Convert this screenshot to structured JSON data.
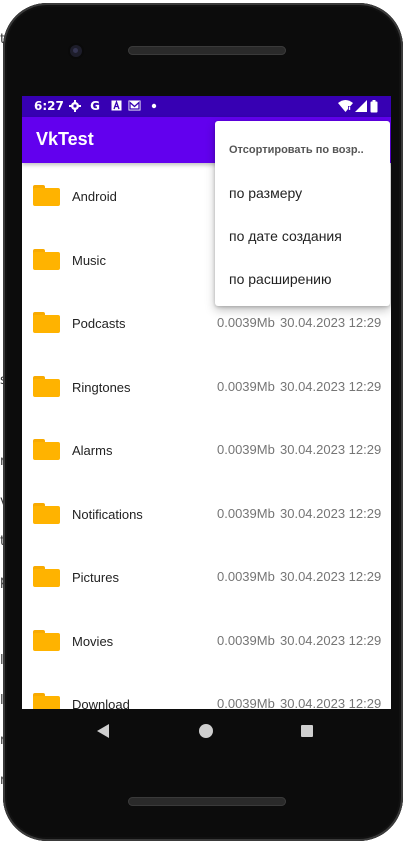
{
  "background_glyphs": [
    "t",
    "s",
    "n",
    "v",
    "t",
    "p",
    "l",
    "l",
    "n",
    "n"
  ],
  "status_bar": {
    "time": "6:27",
    "left_icons": [
      "gear-icon",
      "google-icon",
      "a-box-icon",
      "gmail-icon",
      "dot-icon"
    ],
    "right_icons": [
      "wifi-icon",
      "signal-icon",
      "battery-icon"
    ]
  },
  "app_bar": {
    "title": "VkTest"
  },
  "sort_menu": {
    "header": "Отсортировать по возр..",
    "items": [
      "по размеру",
      "по дате создания",
      "по расширению"
    ]
  },
  "files": [
    {
      "name": "Android",
      "size": "",
      "date": ""
    },
    {
      "name": "Music",
      "size": "",
      "date": ""
    },
    {
      "name": "Podcasts",
      "size": "0.0039Mb",
      "date": "30.04.2023 12:29"
    },
    {
      "name": "Ringtones",
      "size": "0.0039Mb",
      "date": "30.04.2023 12:29"
    },
    {
      "name": "Alarms",
      "size": "0.0039Mb",
      "date": "30.04.2023 12:29"
    },
    {
      "name": "Notifications",
      "size": "0.0039Mb",
      "date": "30.04.2023 12:29"
    },
    {
      "name": "Pictures",
      "size": "0.0039Mb",
      "date": "30.04.2023 12:29"
    },
    {
      "name": "Movies",
      "size": "0.0039Mb",
      "date": "30.04.2023 12:29"
    },
    {
      "name": "Download",
      "size": "0.0039Mb",
      "date": "30.04.2023 12:29"
    }
  ],
  "colors": {
    "status_bar": "#3700b3",
    "app_bar": "#6200ee",
    "folder": "#ffb300",
    "meta_text": "#757575"
  },
  "nav_bar": {
    "icons": [
      "back-icon",
      "home-icon",
      "recents-icon"
    ]
  }
}
